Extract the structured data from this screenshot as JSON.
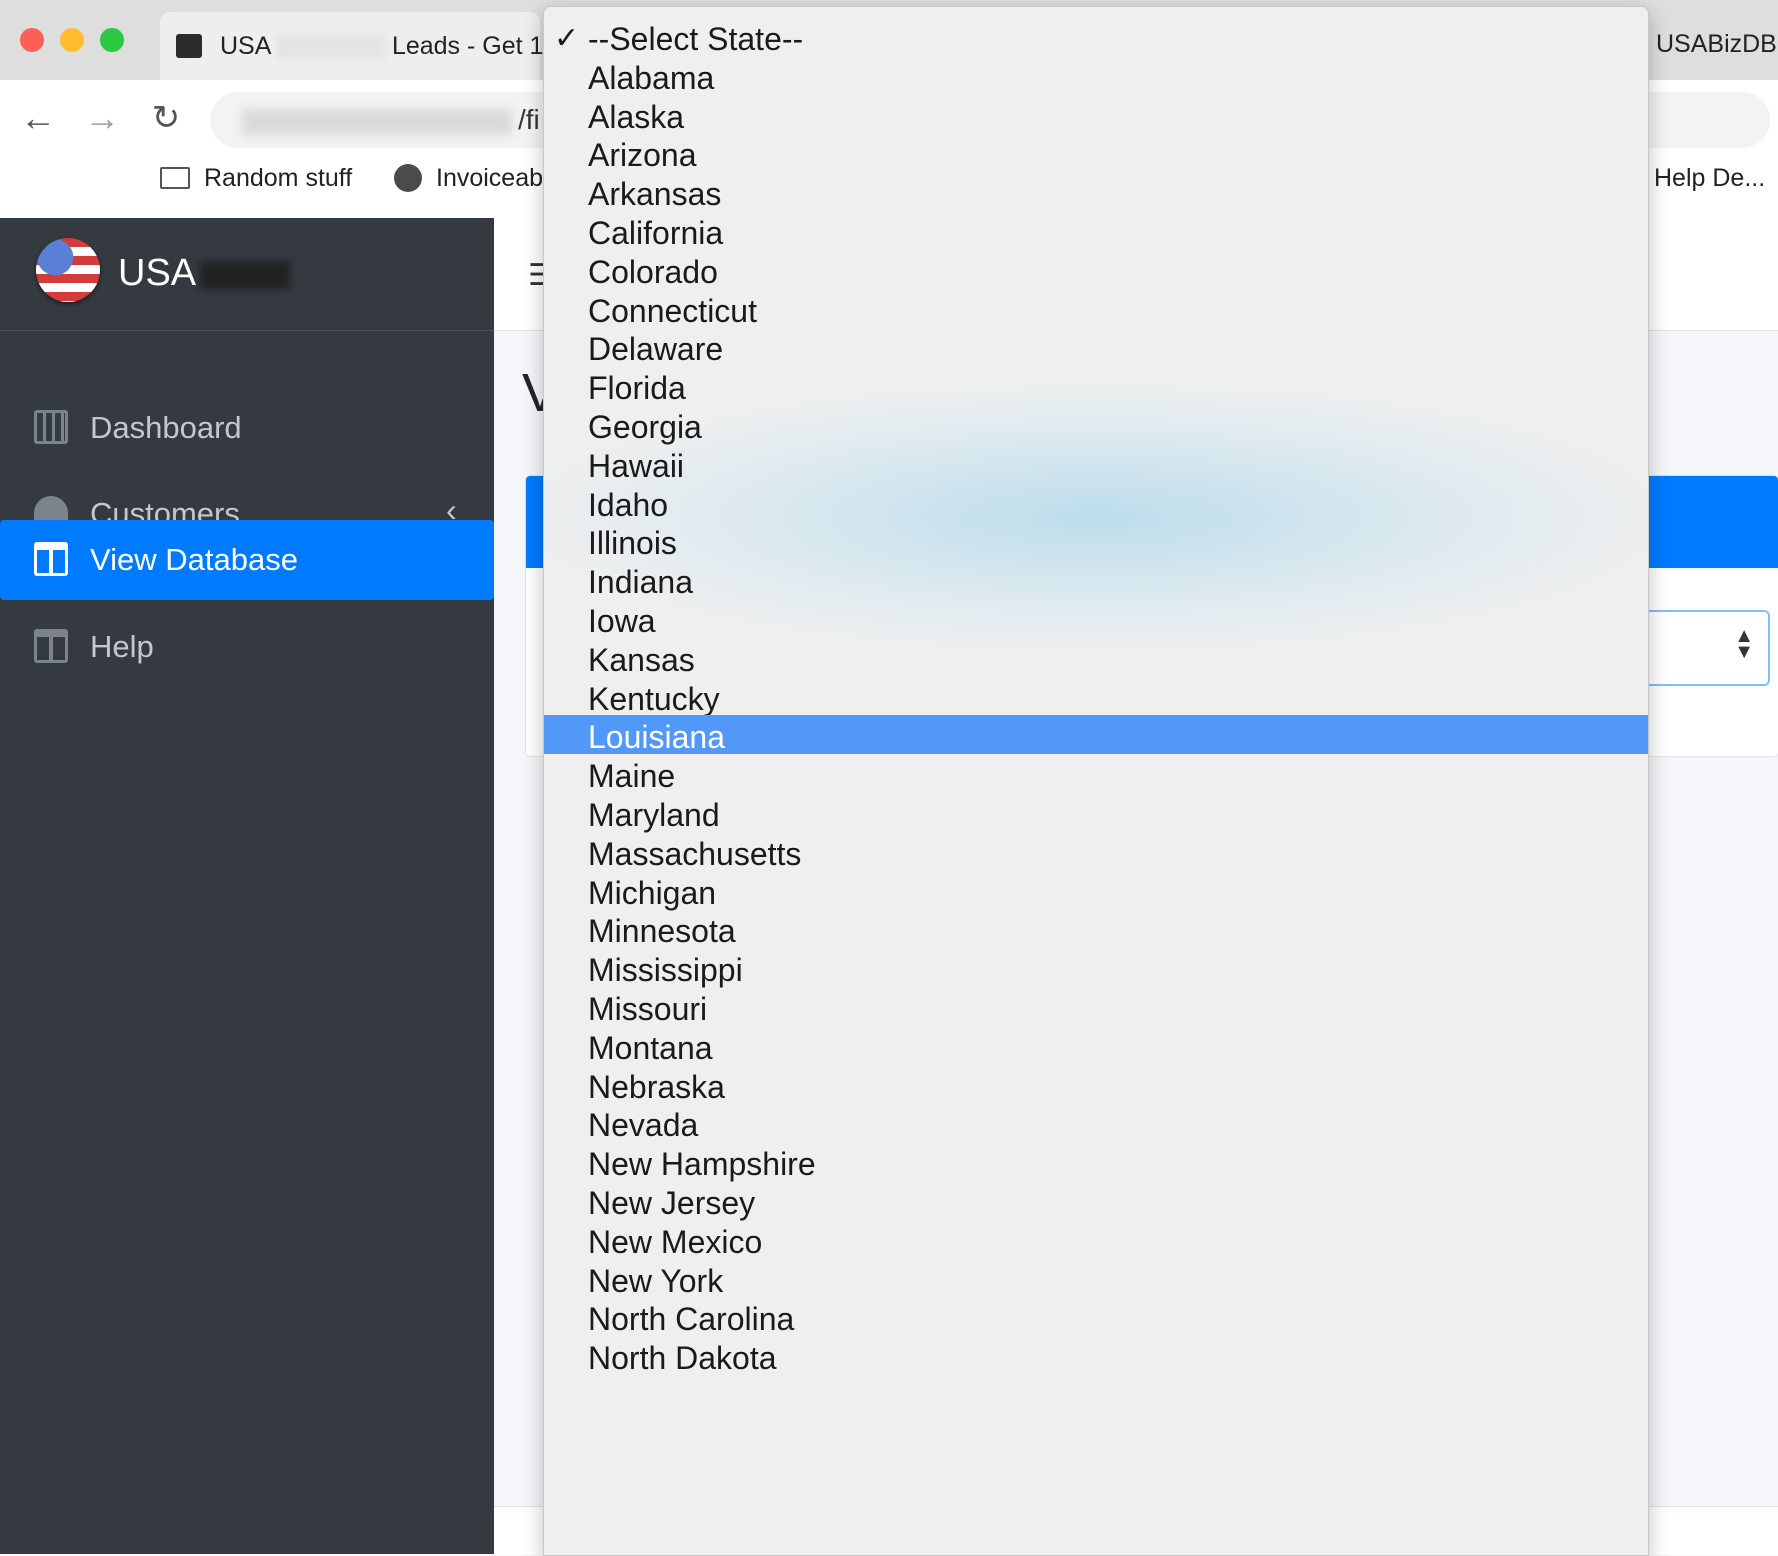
{
  "browser": {
    "tab1_title_left": "USA",
    "tab1_title_right": "Leads - Get 1",
    "tab2_title": "USABizDB",
    "url_suffix": "/fi",
    "bookmarks": [
      "Random stuff",
      "Invoiceab",
      "Help De..."
    ]
  },
  "app": {
    "brand": "USA",
    "nav": [
      {
        "label": "Dashboard",
        "icon": "calendar-icon",
        "active": false
      },
      {
        "label": "Customers",
        "icon": "gauge-icon",
        "active": false,
        "has_submenu": true
      },
      {
        "label": "View Database",
        "icon": "table-icon",
        "active": true
      },
      {
        "label": "Help",
        "icon": "table-icon",
        "active": false
      }
    ],
    "page_title_initial": "V",
    "accent_color": "#007bff",
    "sidebar_color": "#343a40"
  },
  "dropdown": {
    "selected_index": 18,
    "checked_index": 0,
    "options": [
      "--Select State--",
      "Alabama",
      "Alaska",
      "Arizona",
      "Arkansas",
      "California",
      "Colorado",
      "Connecticut",
      "Delaware",
      "Florida",
      "Georgia",
      "Hawaii",
      "Idaho",
      "Illinois",
      "Indiana",
      "Iowa",
      "Kansas",
      "Kentucky",
      "Louisiana",
      "Maine",
      "Maryland",
      "Massachusetts",
      "Michigan",
      "Minnesota",
      "Mississippi",
      "Missouri",
      "Montana",
      "Nebraska",
      "Nevada",
      "New Hampshire",
      "New Jersey",
      "New Mexico",
      "New York",
      "North Carolina",
      "North Dakota"
    ],
    "highlight_color": "#5298f8"
  }
}
